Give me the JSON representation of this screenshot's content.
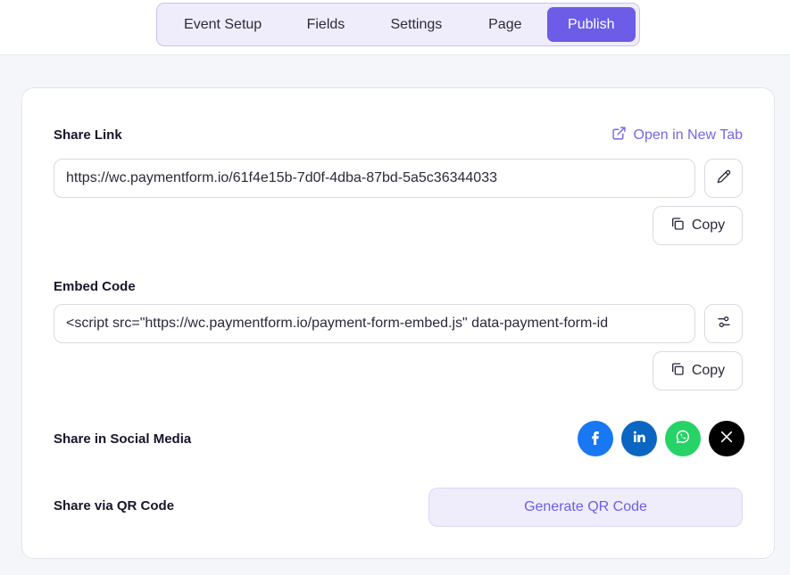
{
  "tabs": [
    {
      "label": "Event Setup"
    },
    {
      "label": "Fields"
    },
    {
      "label": "Settings"
    },
    {
      "label": "Page"
    },
    {
      "label": "Publish"
    }
  ],
  "share_link": {
    "label": "Share Link",
    "open_new_tab": "Open in New Tab",
    "url": "https://wc.paymentform.io/61f4e15b-7d0f-4dba-87bd-5a5c36344033",
    "copy_label": "Copy",
    "edit_icon": "pencil-icon"
  },
  "embed_code": {
    "label": "Embed Code",
    "value": "<script src=\"https://wc.paymentform.io/payment-form-embed.js\" data-payment-form-id",
    "copy_label": "Copy",
    "settings_icon": "sliders-icon"
  },
  "social": {
    "label": "Share in Social Media",
    "networks": [
      "facebook-icon",
      "linkedin-icon",
      "whatsapp-icon",
      "x-icon"
    ]
  },
  "qr": {
    "label": "Share via QR Code",
    "button_label": "Generate QR Code"
  },
  "colors": {
    "accent": "#6c5ce7",
    "facebook": "#1877f2",
    "linkedin": "#0a66c2",
    "whatsapp": "#25d366",
    "x": "#000000"
  }
}
